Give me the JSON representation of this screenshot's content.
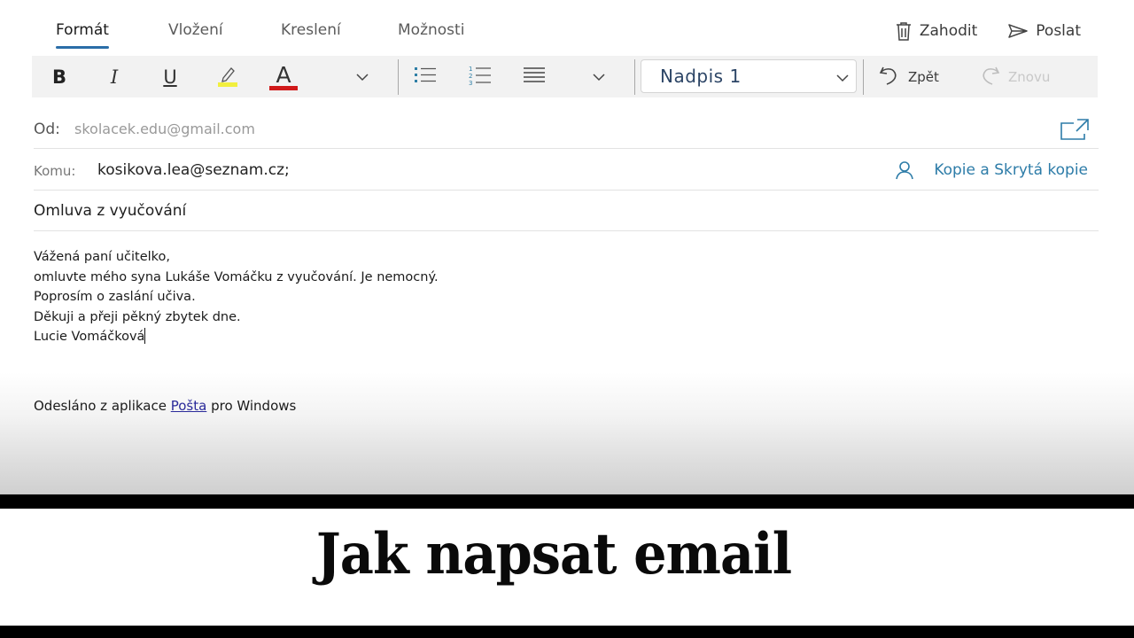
{
  "tabs": [
    {
      "label": "Formát",
      "active": true
    },
    {
      "label": "Vložení",
      "active": false
    },
    {
      "label": "Kreslení",
      "active": false
    },
    {
      "label": "Možnosti",
      "active": false
    }
  ],
  "actions": {
    "discard": {
      "label": "Zahodit",
      "icon": "trash-icon"
    },
    "send": {
      "label": "Poslat",
      "icon": "send-icon"
    }
  },
  "toolbar": {
    "bold": "B",
    "italic": "I",
    "underline": "U",
    "font_color_glyph": "A",
    "highlight_color": "#f1ef3e",
    "font_color": "#d0191a",
    "style_value": "Nadpis 1",
    "undo_label": "Zpět",
    "redo_label": "Znovu"
  },
  "header": {
    "from_label": "Od:",
    "from_value": "skolacek.edu@gmail.com",
    "to_label": "Komu:",
    "to_value": "kosikova.lea@seznam.cz;",
    "cc_label": "Kopie a Skrytá kopie",
    "subject": "Omluva z vyučování"
  },
  "body": {
    "lines": [
      "Vážená paní učitelko,",
      "omluvte mého syna Lukáše Vomáčku z vyučování. Je nemocný.",
      "Poprosím o zaslání učiva.",
      "Děkuji a přeji pěkný zbytek dne.",
      "Lucie Vomáčková"
    ],
    "signature_prefix": "Odesláno z aplikace ",
    "signature_link": "Pošta",
    "signature_suffix": " pro Windows"
  },
  "banner": {
    "title": "Jak napsat email"
  },
  "colors": {
    "accent": "#2b6ea8",
    "link": "#2d7ca8",
    "list_icon": "#2f7fa6"
  }
}
